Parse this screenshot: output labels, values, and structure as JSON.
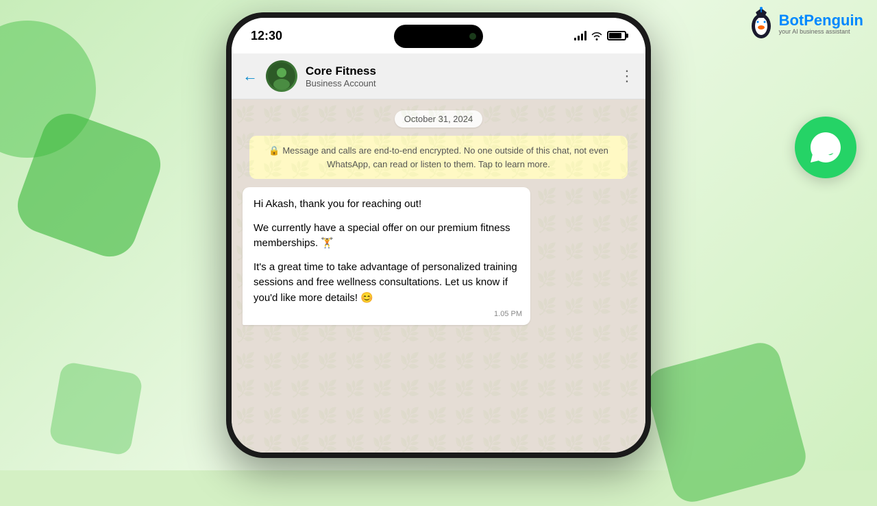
{
  "background": {
    "color": "#c8edba"
  },
  "logo": {
    "name": "Bot",
    "name_accent": "Penguin",
    "tagline": "your AI business assistant"
  },
  "phone": {
    "status_bar": {
      "time": "12:30",
      "signal_bars": 4,
      "wifi": true,
      "battery_percent": 80
    },
    "header": {
      "back_label": "←",
      "contact_name": "Core Fitness",
      "contact_status": "Business Account",
      "more_options_label": "⋮"
    },
    "chat": {
      "date_badge": "October 31, 2024",
      "encryption_notice": "Message and calls are end-to-end encrypted. No one outside of this chat, not even WhatsApp, can read or listen to them. Tap to learn more.",
      "message": {
        "paragraph1": "Hi Akash, thank you for reaching out!",
        "paragraph2": "We currently have a special offer on our premium fitness memberships. 🏋",
        "paragraph3": "It's a great time to take advantage of personalized training sessions and free wellness consultations. Let us know if you'd like more details! 😊",
        "time": "1.05 PM"
      }
    }
  }
}
